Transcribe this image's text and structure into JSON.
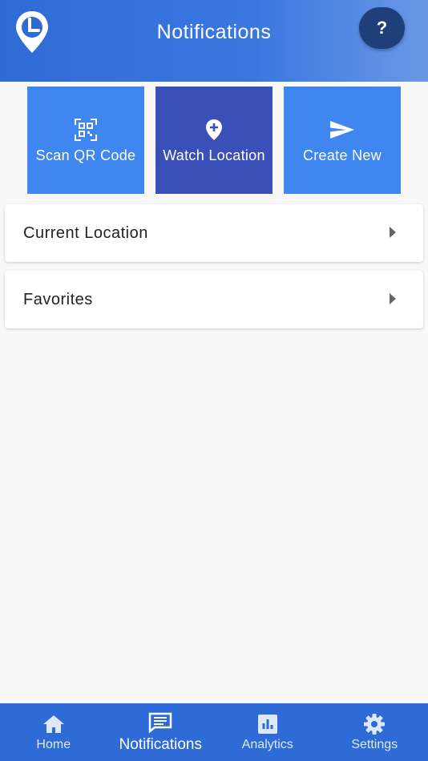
{
  "header": {
    "title": "Notifications",
    "help_label": "?"
  },
  "actions": [
    {
      "label": "Scan QR Code",
      "icon": "qr-code-icon"
    },
    {
      "label": "Watch Location",
      "icon": "add-location-icon"
    },
    {
      "label": "Create New",
      "icon": "send-icon"
    }
  ],
  "cards": [
    {
      "label": "Current Location"
    },
    {
      "label": "Favorites"
    }
  ],
  "nav": [
    {
      "label": "Home",
      "icon": "home-icon"
    },
    {
      "label": "Notifications",
      "icon": "notifications-icon"
    },
    {
      "label": "Analytics",
      "icon": "analytics-icon"
    },
    {
      "label": "Settings",
      "icon": "settings-icon"
    }
  ],
  "colors": {
    "header": "#2f6bd6",
    "action": "#3f86f1",
    "action_active": "#3b4fb8",
    "help_button": "#1e3f7a",
    "nav": "#2e6bd6"
  }
}
